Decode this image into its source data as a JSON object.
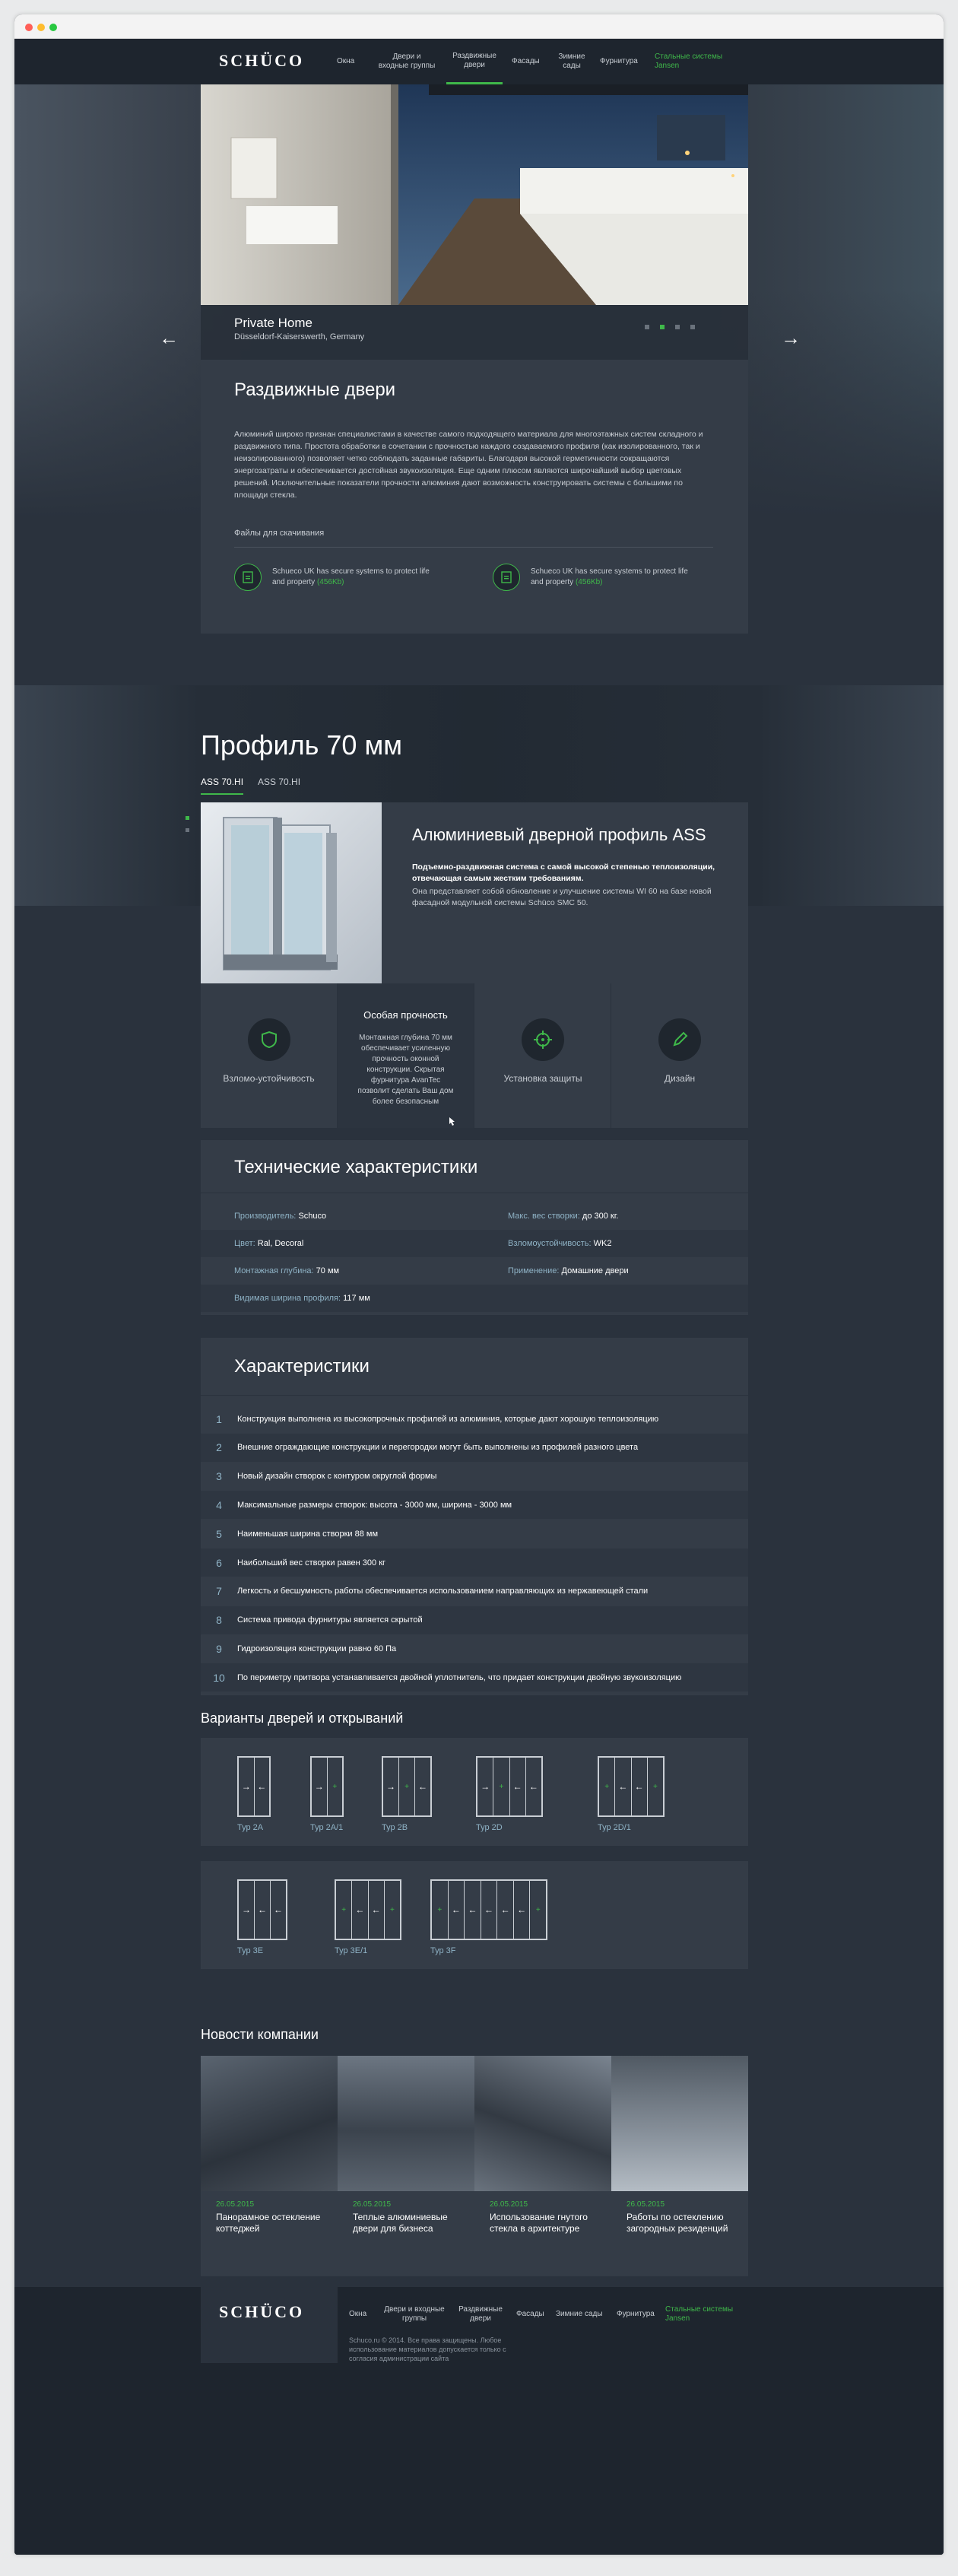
{
  "nav": {
    "logo": "SCHÜCO",
    "items": [
      {
        "label": "Окна"
      },
      {
        "label": "Двери и входные группы"
      },
      {
        "label": "Раздвижные двери"
      },
      {
        "label": "Фасады"
      },
      {
        "label": "Зимние сады"
      },
      {
        "label": "Фурнитура"
      },
      {
        "label": "Стальные системы Jansen"
      }
    ]
  },
  "hero": {
    "title": "Private Home",
    "subtitle": "Düsseldorf-Kaiserswerth, Germany",
    "prev_arrow": "←",
    "next_arrow": "→",
    "slide_count": 4,
    "active_slide": 2
  },
  "sliding": {
    "heading": "Раздвижные двери",
    "body": "Алюминий широко признан специалистами в качестве самого подходящего материала для многоэтажных систем складного и раздвижного типа. Простота обработки в сочетании с прочностью каждого создаваемого профиля (как изолированного, так и неизолированного) позволяет четко соблюдать заданные габариты. Благодаря высокой герметичности сокращаются энергозатраты и обеспечивается достойная звукоизоляция. Еще одним плюсом являются широчайший выбор цветовых решений. Исключительные показатели прочности алюминия дают возможность конструировать системы с большими по площади стекла.",
    "files_label": "Файлы для скачивания",
    "files": [
      {
        "icon": "pdf-icon",
        "text": "Schueco UK has secure systems to protect life and property",
        "size": "(456Kb)"
      },
      {
        "icon": "pdf-icon",
        "text": "Schueco UK has secure systems to protect life and property",
        "size": "(456Kb)"
      }
    ]
  },
  "profile": {
    "heading": "Профиль 70 мм",
    "tabs": [
      "ASS 70.HI",
      "ASS 70.HI"
    ],
    "product_title": "Алюминиевый дверной профиль ASS",
    "product_bold": "Подъемно-раздвижная система с самой высокой степенью теплоизоляции, отвечающая самым жестким требованиям.",
    "product_text": "Она представляет собой обновление и улучшение системы WI 60 на базе новой фасадной модульной системы Schüco SMC 50."
  },
  "features": [
    {
      "label": "Взломо-устойчивость",
      "icon": "shield-icon"
    },
    {
      "title": "Особая прочность",
      "text": "Монтажная глубина 70 мм обеспечивает усиленную прочность оконной конструкции. Скрытая фурнитура AvanTec позволит сделать Ваш дом более безопасным"
    },
    {
      "label": "Установка защиты",
      "icon": "crosshair-icon"
    },
    {
      "label": "Дизайн",
      "icon": "pencil-icon"
    }
  ],
  "specs": {
    "heading": "Технические характеристики",
    "rows": [
      [
        {
          "k": "Производитель:",
          "v": "Schuco"
        },
        {
          "k": "Макс. вес створки:",
          "v": "до 300 кг."
        }
      ],
      [
        {
          "k": "Цвет:",
          "v": "Ral, Decoral"
        },
        {
          "k": "Взломоустойчивость:",
          "v": "WK2"
        }
      ],
      [
        {
          "k": "Монтажная глубина:",
          "v": "70 мм"
        },
        {
          "k": "Применение:",
          "v": "Домашние двери"
        }
      ],
      [
        {
          "k": "Видимая ширина профиля:",
          "v": "117 мм"
        },
        {
          "k": "",
          "v": ""
        }
      ]
    ]
  },
  "characteristics": {
    "heading": "Характеристики",
    "items": [
      "Конструкция выполнена из высокопрочных профилей из алюминия, которые дают хорошую теплоизоляцию",
      "Внешние ограждающие конструкции и перегородки могут быть выполнены из профилей разного цвета",
      "Новый дизайн створок с контуром округлой формы",
      "Максимальные размеры створок: высота - 3000 мм, ширина - 3000 мм",
      "Наименьшая ширина створки 88 мм",
      "Наибольший вес створки равен 300 кг",
      "Легкость и бесшумность работы обеспечивается использованием направляющих из нержавеющей стали",
      "Система привода фурнитуры является скрытой",
      "Гидроизоляция конструкции равно 60 Па",
      "По периметру притвора устанавливается двойной уплотнитель, что придает конструкции двойную звукоизоляцию"
    ]
  },
  "doors": {
    "heading": "Варианты дверей и открываний",
    "row1": [
      {
        "label": "Тур 2А",
        "leaves": [
          "→",
          "←"
        ]
      },
      {
        "label": "Тур 2А/1",
        "leaves": [
          "→",
          "+"
        ]
      },
      {
        "label": "Тур 2В",
        "leaves": [
          "→",
          "+",
          "←"
        ]
      },
      {
        "label": "Тур 2D",
        "leaves": [
          "→",
          "+",
          "←",
          "←"
        ]
      },
      {
        "label": "Тур 2D/1",
        "leaves": [
          "+",
          "←",
          "←",
          "+"
        ]
      }
    ],
    "row2": [
      {
        "label": "Тур 3Е",
        "leaves": [
          "→",
          "←",
          "←"
        ]
      },
      {
        "label": "Тур 3Е/1",
        "leaves": [
          "+",
          "←",
          "←",
          "+"
        ]
      },
      {
        "label": "Тур 3F",
        "leaves": [
          "+",
          "←",
          "←",
          "←",
          "←",
          "←",
          "+"
        ]
      }
    ]
  },
  "news": {
    "heading": "Новости компании",
    "items": [
      {
        "date": "26.05.2015",
        "title": "Панорамное остекление коттеджей"
      },
      {
        "date": "26.05.2015",
        "title": "Теплые алюминиевые двери для бизнеса"
      },
      {
        "date": "26.05.2015",
        "title": "Использование гнутого стекла в архитектуре"
      },
      {
        "date": "26.05.2015",
        "title": "Работы по остеклению загородных резиденций"
      }
    ]
  },
  "footer": {
    "copyright": "Schuco.ru © 2014. Все права защищены. Любое использование материалов допускается только с согласия администрации сайта"
  },
  "colors": {
    "accent": "#3fb84a",
    "bg": "#2a323d",
    "panel": "#343c47",
    "header": "#1e252e"
  }
}
